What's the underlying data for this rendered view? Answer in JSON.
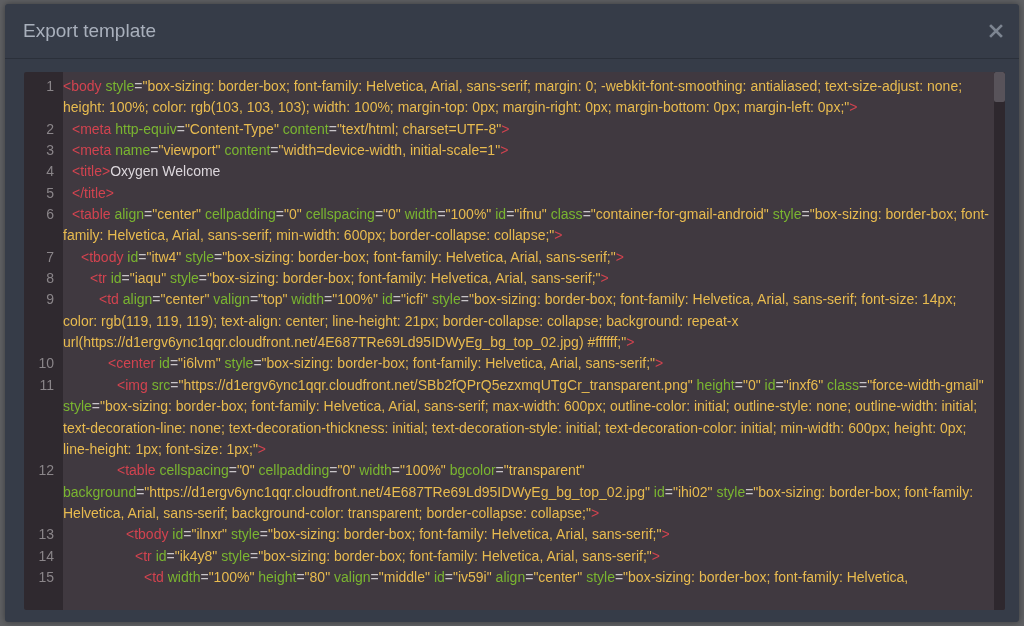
{
  "dialog": {
    "title": "Export template",
    "code": [
      {
        "number": "1",
        "tokens": [
          {
            "kind": "tag",
            "text": "<body"
          },
          {
            "kind": "attr",
            "text": "style"
          },
          {
            "kind": "eq",
            "text": "="
          },
          {
            "kind": "value",
            "text": "\"box-sizing: border-box; font-family: Helvetica, Arial, sans-serif; margin: 0; -webkit-font-smoothing: antialiased; text-size-adjust: none; height: 100%; color: rgb(103, 103, 103); width: 100%; margin-top: 0px; margin-right: 0px; margin-bottom: 0px; margin-left: 0px;\""
          },
          {
            "kind": "tag",
            "text": ">"
          }
        ],
        "children": [
          {
            "number": "2",
            "tokens": [
              {
                "kind": "tag",
                "text": "<meta"
              },
              {
                "kind": "attr",
                "text": "http-equiv"
              },
              {
                "kind": "eq",
                "text": "="
              },
              {
                "kind": "value",
                "text": "\"Content-Type\""
              },
              {
                "kind": "attr",
                "text": "content"
              },
              {
                "kind": "eq",
                "text": "="
              },
              {
                "kind": "value",
                "text": "\"text/html; charset=UTF-8\""
              },
              {
                "kind": "tag",
                "text": ">"
              }
            ]
          },
          {
            "number": "3",
            "tokens": [
              {
                "kind": "tag",
                "text": "<meta"
              },
              {
                "kind": "attr",
                "text": "name"
              },
              {
                "kind": "eq",
                "text": "="
              },
              {
                "kind": "value",
                "text": "\"viewport\""
              },
              {
                "kind": "attr",
                "text": "content"
              },
              {
                "kind": "eq",
                "text": "="
              },
              {
                "kind": "value",
                "text": "\"width=device-width, initial-scale=1\""
              },
              {
                "kind": "tag",
                "text": ">"
              }
            ]
          },
          {
            "number": "4",
            "tokens": [
              {
                "kind": "tag",
                "text": "<title>"
              },
              {
                "kind": "text",
                "text": "Oxygen Welcome"
              }
            ]
          },
          {
            "number": "5",
            "tokens": [
              {
                "kind": "tag",
                "text": "</title>"
              }
            ]
          },
          {
            "number": "6",
            "tokens": [
              {
                "kind": "tag",
                "text": "<table"
              },
              {
                "kind": "attr",
                "text": "align"
              },
              {
                "kind": "eq",
                "text": "="
              },
              {
                "kind": "value",
                "text": "\"center\""
              },
              {
                "kind": "attr",
                "text": "cellpadding"
              },
              {
                "kind": "eq",
                "text": "="
              },
              {
                "kind": "value",
                "text": "\"0\""
              },
              {
                "kind": "attr",
                "text": "cellspacing"
              },
              {
                "kind": "eq",
                "text": "="
              },
              {
                "kind": "value",
                "text": "\"0\""
              },
              {
                "kind": "attr",
                "text": "width"
              },
              {
                "kind": "eq",
                "text": "="
              },
              {
                "kind": "value",
                "text": "\"100%\""
              },
              {
                "kind": "attr",
                "text": "id"
              },
              {
                "kind": "eq",
                "text": "="
              },
              {
                "kind": "value",
                "text": "\"ifnu\""
              },
              {
                "kind": "attr",
                "text": "class"
              },
              {
                "kind": "eq",
                "text": "="
              },
              {
                "kind": "value",
                "text": "\"container-for-gmail-android\""
              },
              {
                "kind": "attr",
                "text": "style"
              },
              {
                "kind": "eq",
                "text": "="
              },
              {
                "kind": "value",
                "text": "\"box-sizing: border-box; font-family: Helvetica, Arial, sans-serif; min-width: 600px; border-collapse: collapse;\""
              },
              {
                "kind": "tag",
                "text": ">"
              }
            ],
            "children": [
              {
                "number": "7",
                "tokens": [
                  {
                    "kind": "tag",
                    "text": "<tbody"
                  },
                  {
                    "kind": "attr",
                    "text": "id"
                  },
                  {
                    "kind": "eq",
                    "text": "="
                  },
                  {
                    "kind": "value",
                    "text": "\"itw4\""
                  },
                  {
                    "kind": "attr",
                    "text": "style"
                  },
                  {
                    "kind": "eq",
                    "text": "="
                  },
                  {
                    "kind": "value",
                    "text": "\"box-sizing: border-box; font-family: Helvetica, Arial, sans-serif;\""
                  },
                  {
                    "kind": "tag",
                    "text": ">"
                  }
                ],
                "children": [
                  {
                    "number": "8",
                    "tokens": [
                      {
                        "kind": "tag",
                        "text": "<tr"
                      },
                      {
                        "kind": "attr",
                        "text": "id"
                      },
                      {
                        "kind": "eq",
                        "text": "="
                      },
                      {
                        "kind": "value",
                        "text": "\"iaqu\""
                      },
                      {
                        "kind": "attr",
                        "text": "style"
                      },
                      {
                        "kind": "eq",
                        "text": "="
                      },
                      {
                        "kind": "value",
                        "text": "\"box-sizing: border-box; font-family: Helvetica, Arial, sans-serif;\""
                      },
                      {
                        "kind": "tag",
                        "text": ">"
                      }
                    ],
                    "children": [
                      {
                        "number": "9",
                        "tokens": [
                          {
                            "kind": "tag",
                            "text": "<td"
                          },
                          {
                            "kind": "attr",
                            "text": "align"
                          },
                          {
                            "kind": "eq",
                            "text": "="
                          },
                          {
                            "kind": "value",
                            "text": "\"center\""
                          },
                          {
                            "kind": "attr",
                            "text": "valign"
                          },
                          {
                            "kind": "eq",
                            "text": "="
                          },
                          {
                            "kind": "value",
                            "text": "\"top\""
                          },
                          {
                            "kind": "attr",
                            "text": "width"
                          },
                          {
                            "kind": "eq",
                            "text": "="
                          },
                          {
                            "kind": "value",
                            "text": "\"100%\""
                          },
                          {
                            "kind": "attr",
                            "text": "id"
                          },
                          {
                            "kind": "eq",
                            "text": "="
                          },
                          {
                            "kind": "value",
                            "text": "\"icfi\""
                          },
                          {
                            "kind": "attr",
                            "text": "style"
                          },
                          {
                            "kind": "eq",
                            "text": "="
                          },
                          {
                            "kind": "value",
                            "text": "\"box-sizing: border-box; font-family: Helvetica, Arial, sans-serif; font-size: 14px; color: rgb(119, 119, 119); text-align: center; line-height: 21px; border-collapse: collapse; background: repeat-x url(https://d1ergv6ync1qqr.cloudfront.net/4E687TRe69Ld95IDWyEg_bg_top_02.jpg) #ffffff;\""
                          },
                          {
                            "kind": "tag",
                            "text": ">"
                          }
                        ],
                        "children": [
                          {
                            "number": "10",
                            "tokens": [
                              {
                                "kind": "tag",
                                "text": "<center"
                              },
                              {
                                "kind": "attr",
                                "text": "id"
                              },
                              {
                                "kind": "eq",
                                "text": "="
                              },
                              {
                                "kind": "value",
                                "text": "\"i6lvm\""
                              },
                              {
                                "kind": "attr",
                                "text": "style"
                              },
                              {
                                "kind": "eq",
                                "text": "="
                              },
                              {
                                "kind": "value",
                                "text": "\"box-sizing: border-box; font-family: Helvetica, Arial, sans-serif;\""
                              },
                              {
                                "kind": "tag",
                                "text": ">"
                              }
                            ],
                            "children": [
                              {
                                "number": "11",
                                "tokens": [
                                  {
                                    "kind": "tag",
                                    "text": "<img"
                                  },
                                  {
                                    "kind": "attr",
                                    "text": "src"
                                  },
                                  {
                                    "kind": "eq",
                                    "text": "="
                                  },
                                  {
                                    "kind": "value",
                                    "text": "\"https://d1ergv6ync1qqr.cloudfront.net/SBb2fQPrQ5ezxmqUTgCr_transparent.png\""
                                  },
                                  {
                                    "kind": "attr",
                                    "text": "height"
                                  },
                                  {
                                    "kind": "eq",
                                    "text": "="
                                  },
                                  {
                                    "kind": "value",
                                    "text": "\"0\""
                                  },
                                  {
                                    "kind": "attr",
                                    "text": "id"
                                  },
                                  {
                                    "kind": "eq",
                                    "text": "="
                                  },
                                  {
                                    "kind": "value",
                                    "text": "\"inxf6\""
                                  },
                                  {
                                    "kind": "attr",
                                    "text": "class"
                                  },
                                  {
                                    "kind": "eq",
                                    "text": "="
                                  },
                                  {
                                    "kind": "value",
                                    "text": "\"force-width-gmail\""
                                  },
                                  {
                                    "kind": "attr",
                                    "text": "style"
                                  },
                                  {
                                    "kind": "eq",
                                    "text": "="
                                  },
                                  {
                                    "kind": "value",
                                    "text": "\"box-sizing: border-box; font-family: Helvetica, Arial, sans-serif; max-width: 600px; outline-color: initial; outline-style: none; outline-width: initial; text-decoration-line: none; text-decoration-thickness: initial; text-decoration-style: initial; text-decoration-color: initial; min-width: 600px; height: 0px; line-height: 1px; font-size: 1px;\""
                                  },
                                  {
                                    "kind": "tag",
                                    "text": ">"
                                  }
                                ]
                              },
                              {
                                "number": "12",
                                "tokens": [
                                  {
                                    "kind": "tag",
                                    "text": "<table"
                                  },
                                  {
                                    "kind": "attr",
                                    "text": "cellspacing"
                                  },
                                  {
                                    "kind": "eq",
                                    "text": "="
                                  },
                                  {
                                    "kind": "value",
                                    "text": "\"0\""
                                  },
                                  {
                                    "kind": "attr",
                                    "text": "cellpadding"
                                  },
                                  {
                                    "kind": "eq",
                                    "text": "="
                                  },
                                  {
                                    "kind": "value",
                                    "text": "\"0\""
                                  },
                                  {
                                    "kind": "attr",
                                    "text": "width"
                                  },
                                  {
                                    "kind": "eq",
                                    "text": "="
                                  },
                                  {
                                    "kind": "value",
                                    "text": "\"100%\""
                                  },
                                  {
                                    "kind": "attr",
                                    "text": "bgcolor"
                                  },
                                  {
                                    "kind": "eq",
                                    "text": "="
                                  },
                                  {
                                    "kind": "value",
                                    "text": "\"transparent\""
                                  },
                                  {
                                    "kind": "attr",
                                    "text": "background"
                                  },
                                  {
                                    "kind": "eq",
                                    "text": "="
                                  },
                                  {
                                    "kind": "value",
                                    "text": "\"https://d1ergv6ync1qqr.cloudfront.net/4E687TRe69Ld95IDWyEg_bg_top_02.jpg\""
                                  },
                                  {
                                    "kind": "attr",
                                    "text": "id"
                                  },
                                  {
                                    "kind": "eq",
                                    "text": "="
                                  },
                                  {
                                    "kind": "value",
                                    "text": "\"ihi02\""
                                  },
                                  {
                                    "kind": "attr",
                                    "text": "style"
                                  },
                                  {
                                    "kind": "eq",
                                    "text": "="
                                  },
                                  {
                                    "kind": "value",
                                    "text": "\"box-sizing: border-box; font-family: Helvetica, Arial, sans-serif; background-color: transparent; border-collapse: collapse;\""
                                  },
                                  {
                                    "kind": "tag",
                                    "text": ">"
                                  }
                                ],
                                "children": [
                                  {
                                    "number": "13",
                                    "tokens": [
                                      {
                                        "kind": "tag",
                                        "text": "<tbody"
                                      },
                                      {
                                        "kind": "attr",
                                        "text": "id"
                                      },
                                      {
                                        "kind": "eq",
                                        "text": "="
                                      },
                                      {
                                        "kind": "value",
                                        "text": "\"ilnxr\""
                                      },
                                      {
                                        "kind": "attr",
                                        "text": "style"
                                      },
                                      {
                                        "kind": "eq",
                                        "text": "="
                                      },
                                      {
                                        "kind": "value",
                                        "text": "\"box-sizing: border-box; font-family: Helvetica, Arial, sans-serif;\""
                                      },
                                      {
                                        "kind": "tag",
                                        "text": ">"
                                      }
                                    ],
                                    "children": [
                                      {
                                        "number": "14",
                                        "tokens": [
                                          {
                                            "kind": "tag",
                                            "text": "<tr"
                                          },
                                          {
                                            "kind": "attr",
                                            "text": "id"
                                          },
                                          {
                                            "kind": "eq",
                                            "text": "="
                                          },
                                          {
                                            "kind": "value",
                                            "text": "\"ik4y8\""
                                          },
                                          {
                                            "kind": "attr",
                                            "text": "style"
                                          },
                                          {
                                            "kind": "eq",
                                            "text": "="
                                          },
                                          {
                                            "kind": "value",
                                            "text": "\"box-sizing: border-box; font-family: Helvetica, Arial, sans-serif;\""
                                          },
                                          {
                                            "kind": "tag",
                                            "text": ">"
                                          }
                                        ],
                                        "children": [
                                          {
                                            "number": "15",
                                            "tokens": [
                                              {
                                                "kind": "tag",
                                                "text": "<td"
                                              },
                                              {
                                                "kind": "attr",
                                                "text": "width"
                                              },
                                              {
                                                "kind": "eq",
                                                "text": "="
                                              },
                                              {
                                                "kind": "value",
                                                "text": "\"100%\""
                                              },
                                              {
                                                "kind": "attr",
                                                "text": "height"
                                              },
                                              {
                                                "kind": "eq",
                                                "text": "="
                                              },
                                              {
                                                "kind": "value",
                                                "text": "\"80\""
                                              },
                                              {
                                                "kind": "attr",
                                                "text": "valign"
                                              },
                                              {
                                                "kind": "eq",
                                                "text": "="
                                              },
                                              {
                                                "kind": "value",
                                                "text": "\"middle\""
                                              },
                                              {
                                                "kind": "attr",
                                                "text": "id"
                                              },
                                              {
                                                "kind": "eq",
                                                "text": "="
                                              },
                                              {
                                                "kind": "value",
                                                "text": "\"iv59i\""
                                              },
                                              {
                                                "kind": "attr",
                                                "text": "align"
                                              },
                                              {
                                                "kind": "eq",
                                                "text": "="
                                              },
                                              {
                                                "kind": "value",
                                                "text": "\"center\""
                                              },
                                              {
                                                "kind": "attr",
                                                "text": "style"
                                              },
                                              {
                                                "kind": "eq",
                                                "text": "="
                                              },
                                              {
                                                "kind": "value",
                                                "text": "\"box-sizing: border-box; font-family: Helvetica,"
                                              }
                                            ]
                                          }
                                        ]
                                      }
                                    ]
                                  }
                                ]
                              }
                            ]
                          }
                        ]
                      }
                    ]
                  }
                ]
              }
            ]
          }
        ]
      }
    ]
  }
}
